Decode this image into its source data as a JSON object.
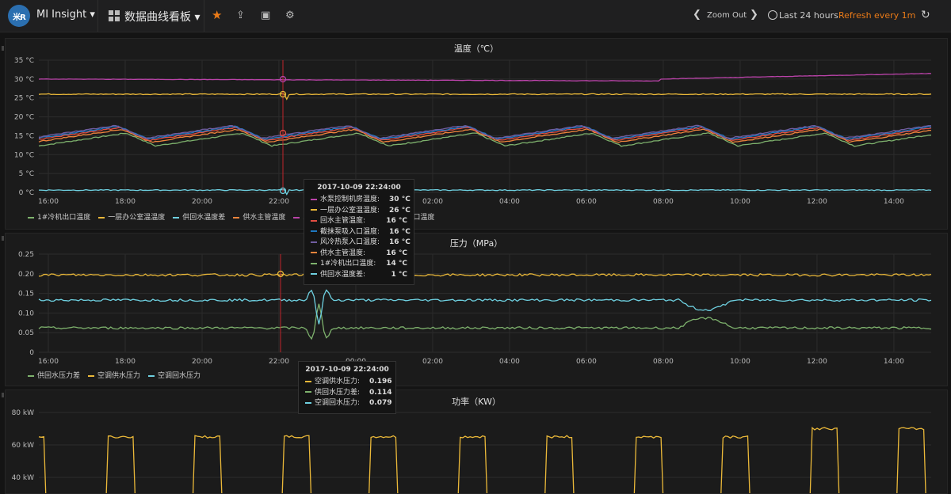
{
  "header": {
    "logo_text": "米R",
    "brand": "MI Insight ▾",
    "dashboard_title": "数据曲线看板 ▾",
    "zoom_out": "Zoom Out",
    "time_range": "Last 24 hours",
    "refresh": "Refresh every 1m",
    "icons": [
      "star-icon",
      "share-icon",
      "save-icon",
      "gear-icon",
      "chevron-left-icon",
      "chevron-right-icon",
      "clock-icon",
      "refresh-icon"
    ],
    "accent": "#eb7b18"
  },
  "x_ticks": [
    "16:00",
    "18:00",
    "20:00",
    "22:00",
    "00:00",
    "02:00",
    "04:00",
    "06:00",
    "08:00",
    "10:00",
    "12:00",
    "14:00"
  ],
  "chart_data": [
    {
      "type": "line",
      "title": "温度（℃）",
      "ylim": [
        0,
        35
      ],
      "y_ticks": [
        "0 °C",
        "5 °C",
        "10 °C",
        "15 °C",
        "20 °C",
        "25 °C",
        "30 °C",
        "35 °C"
      ],
      "grid": true,
      "legend_position": "bottom",
      "series": [
        {
          "name": "1#冷机出口温度",
          "color": "#7eb26d",
          "kind": "saw",
          "base": 14
        },
        {
          "name": "一层办公室温温度",
          "color": "#eab839",
          "kind": "flat",
          "base": 26
        },
        {
          "name": "供回水温度差",
          "color": "#6ed0e0",
          "kind": "flat",
          "base": 0.6
        },
        {
          "name": "供水主管温度",
          "color": "#ef843c",
          "kind": "saw",
          "base": 15
        },
        {
          "name": "回水主管温度",
          "color": "#e24d42",
          "kind": "saw",
          "base": 15.5
        },
        {
          "name": "截抹泵吸入口温度",
          "color": "#1f78c1",
          "kind": "saw",
          "base": 15.8
        },
        {
          "name": "水泵控制机房温度",
          "color": "#ba43a9",
          "kind": "rising",
          "base": 30
        },
        {
          "name": "风冷热泵入口温度",
          "color": "#705da0",
          "kind": "saw",
          "base": 16
        }
      ],
      "legend_visible": [
        "1#冷机出口温度",
        "一层办公室温温度",
        "供回水温度差",
        "供水主管温度",
        "",
        "",
        "水泵控制机房温度",
        "风冷热泵入口温度"
      ],
      "tooltip": {
        "time": "2017-10-09 22:24:00",
        "rows": [
          {
            "label": "水泵控制机房温度:",
            "value": "30 °C",
            "color": "#ba43a9"
          },
          {
            "label": "一层办公室温温度:",
            "value": "26 °C",
            "color": "#eab839"
          },
          {
            "label": "回水主管温度:",
            "value": "16 °C",
            "color": "#e24d42"
          },
          {
            "label": "截抹泵吸入口温度:",
            "value": "16 °C",
            "color": "#1f78c1"
          },
          {
            "label": "风冷热泵入口温度:",
            "value": "16 °C",
            "color": "#705da0"
          },
          {
            "label": "供水主管温度:",
            "value": "16 °C",
            "color": "#ef843c"
          },
          {
            "label": "1#冷机出口温度:",
            "value": "14 °C",
            "color": "#7eb26d"
          },
          {
            "label": "供回水温度差:",
            "value": "1 °C",
            "color": "#6ed0e0"
          }
        ]
      }
    },
    {
      "type": "line",
      "title": "压力（MPa）",
      "ylim": [
        0,
        0.25
      ],
      "y_ticks": [
        "0",
        "0.05",
        "0.10",
        "0.15",
        "0.20",
        "0.25"
      ],
      "grid": true,
      "legend_position": "bottom",
      "series": [
        {
          "name": "供回水压力差",
          "color": "#7eb26d",
          "kind": "noisy",
          "base": 0.062
        },
        {
          "name": "空调供水压力",
          "color": "#eab839",
          "kind": "noisy",
          "base": 0.197
        },
        {
          "name": "空调回水压力",
          "color": "#6ed0e0",
          "kind": "noisy",
          "base": 0.133
        }
      ],
      "tooltip": {
        "time": "2017-10-09 22:24:00",
        "rows": [
          {
            "label": "空调供水压力:",
            "value": "0.196",
            "color": "#eab839"
          },
          {
            "label": "供回水压力差:",
            "value": "0.114",
            "color": "#7eb26d"
          },
          {
            "label": "空调回水压力:",
            "value": "0.079",
            "color": "#6ed0e0"
          }
        ]
      }
    },
    {
      "type": "line",
      "title": "功率（KW）",
      "y_ticks": [
        "40 kW",
        "60 kW",
        "80 kW"
      ],
      "grid": true,
      "series": [
        {
          "name": "",
          "color": "#eab839",
          "kind": "pulse",
          "base": 65
        }
      ]
    }
  ]
}
